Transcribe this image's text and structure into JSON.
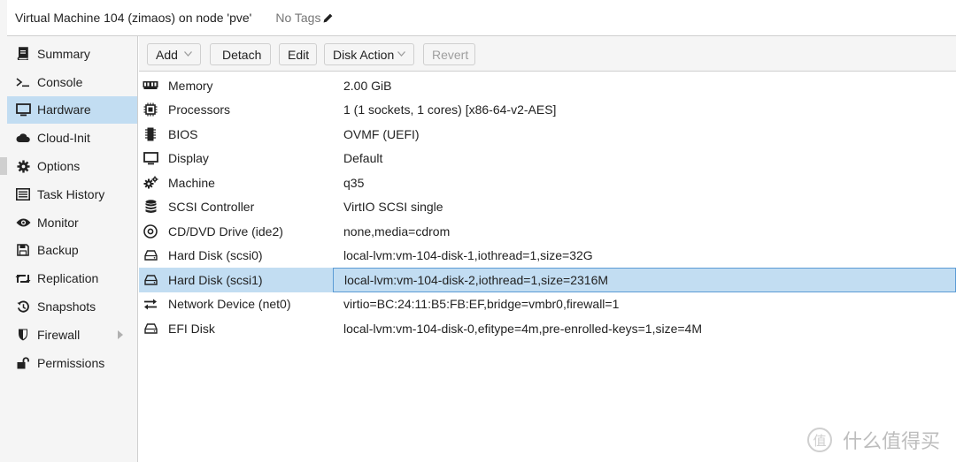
{
  "header": {
    "title": "Virtual Machine 104 (zimaos) on node 'pve'",
    "tags": "No Tags"
  },
  "sidebar": {
    "items": [
      {
        "label": "Summary",
        "icon": "book-icon"
      },
      {
        "label": "Console",
        "icon": "terminal-icon"
      },
      {
        "label": "Hardware",
        "icon": "monitor-icon",
        "active": true
      },
      {
        "label": "Cloud-Init",
        "icon": "cloud-icon"
      },
      {
        "label": "Options",
        "icon": "gear-icon"
      },
      {
        "label": "Task History",
        "icon": "list-icon"
      },
      {
        "label": "Monitor",
        "icon": "eye-icon"
      },
      {
        "label": "Backup",
        "icon": "floppy-icon"
      },
      {
        "label": "Replication",
        "icon": "retweet-icon"
      },
      {
        "label": "Snapshots",
        "icon": "history-icon"
      },
      {
        "label": "Firewall",
        "icon": "shield-icon",
        "expandable": true
      },
      {
        "label": "Permissions",
        "icon": "unlock-icon"
      }
    ]
  },
  "toolbar": {
    "add": "Add",
    "detach": "Detach",
    "edit": "Edit",
    "disk_action": "Disk Action",
    "revert": "Revert"
  },
  "hardware": {
    "rows": [
      {
        "name": "Memory",
        "value": "2.00 GiB",
        "icon": "memory-icon"
      },
      {
        "name": "Processors",
        "value": "1 (1 sockets, 1 cores) [x86-64-v2-AES]",
        "icon": "cpu-icon"
      },
      {
        "name": "BIOS",
        "value": "OVMF (UEFI)",
        "icon": "microchip-icon"
      },
      {
        "name": "Display",
        "value": "Default",
        "icon": "desktop-icon"
      },
      {
        "name": "Machine",
        "value": "q35",
        "icon": "cogs-icon"
      },
      {
        "name": "SCSI Controller",
        "value": "VirtIO SCSI single",
        "icon": "database-icon"
      },
      {
        "name": "CD/DVD Drive (ide2)",
        "value": "none,media=cdrom",
        "icon": "cdrom-icon"
      },
      {
        "name": "Hard Disk (scsi0)",
        "value": "local-lvm:vm-104-disk-1,iothread=1,size=32G",
        "icon": "hdd-icon"
      },
      {
        "name": "Hard Disk (scsi1)",
        "value": "local-lvm:vm-104-disk-2,iothread=1,size=2316M",
        "icon": "hdd-icon",
        "selected": true
      },
      {
        "name": "Network Device (net0)",
        "value": "virtio=BC:24:11:B5:FB:EF,bridge=vmbr0,firewall=1",
        "icon": "exchange-icon"
      },
      {
        "name": "EFI Disk",
        "value": "local-lvm:vm-104-disk-0,efitype=4m,pre-enrolled-keys=1,size=4M",
        "icon": "hdd-icon"
      }
    ]
  },
  "watermark": {
    "badge": "值",
    "text": "什么值得买"
  },
  "colors": {
    "selected_bg": "#c2ddf2",
    "selected_border": "#5b9bd5",
    "panel_bg": "#f5f5f5"
  }
}
